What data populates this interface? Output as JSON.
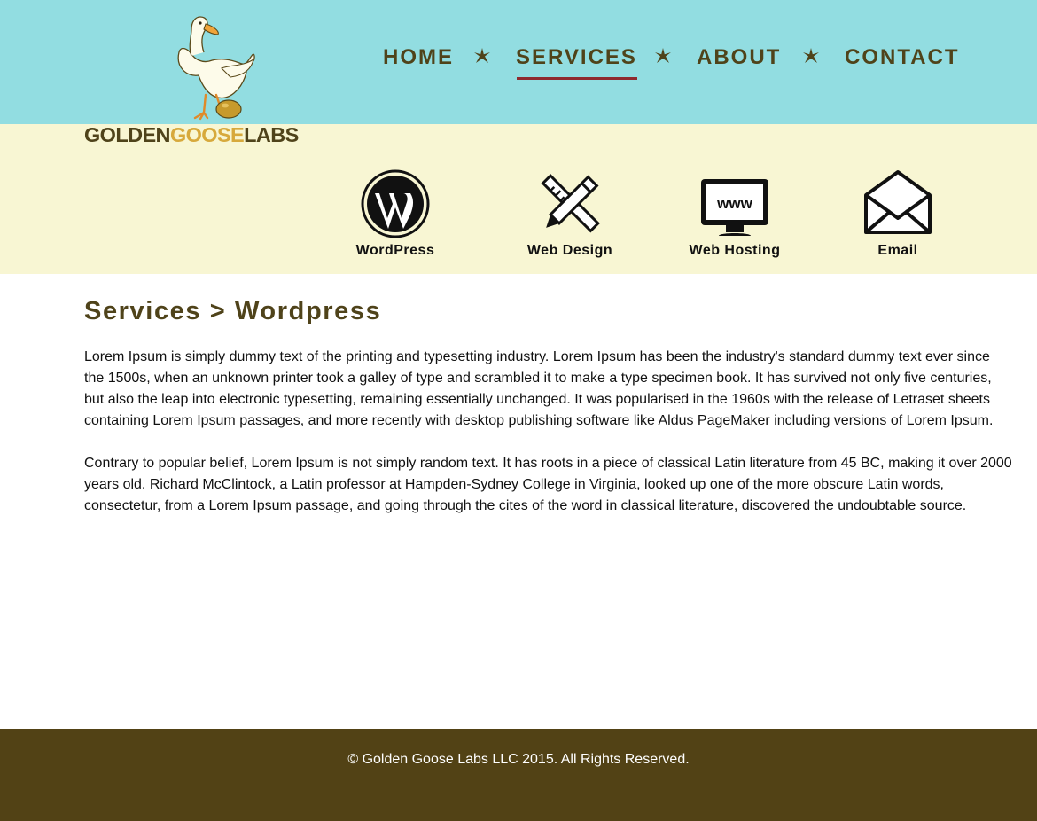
{
  "brand": {
    "logo_part1": "GOLDEN",
    "logo_part2": "GOOSE",
    "logo_part3": "LABS"
  },
  "nav": {
    "items": [
      {
        "label": "HOME",
        "active": false
      },
      {
        "label": "SERVICES",
        "active": true
      },
      {
        "label": "ABOUT",
        "active": false
      },
      {
        "label": "CONTACT",
        "active": false
      }
    ]
  },
  "services": {
    "items": [
      {
        "label": "WordPress",
        "icon": "wordpress-icon"
      },
      {
        "label": "Web Design",
        "icon": "pencil-ruler-icon"
      },
      {
        "label": "Web Hosting",
        "icon": "monitor-www-icon"
      },
      {
        "label": "Email",
        "icon": "envelope-icon"
      }
    ]
  },
  "main": {
    "title": "Services > Wordpress",
    "paragraphs": [
      "Lorem Ipsum is simply dummy text of the printing and typesetting industry. Lorem Ipsum has been the industry's standard dummy text ever since the 1500s, when an unknown printer took a galley of type and scrambled it to make a type specimen book. It has survived not only five centuries, but also the leap into electronic typesetting, remaining essentially unchanged. It was popularised in the 1960s with the release of Letraset sheets containing Lorem Ipsum passages, and more recently with desktop publishing software like Aldus PageMaker including versions of Lorem Ipsum.",
      "Contrary to popular belief, Lorem Ipsum is not simply random text. It has roots in a piece of classical Latin literature from 45 BC, making it over 2000 years old. Richard McClintock, a Latin professor at Hampden-Sydney College in Virginia, looked up one of the more obscure Latin words, consectetur, from a Lorem Ipsum passage, and going through the cites of the word in classical literature, discovered the undoubtable source."
    ]
  },
  "footer": {
    "copyright": "© Golden Goose Labs LLC 2015. All Rights Reserved."
  },
  "colors": {
    "header_bg": "#92dde1",
    "band_bg": "#f8f6d3",
    "brand_brown": "#4f431a",
    "brand_gold": "#d7a93c",
    "active_underline": "#8f2a2f",
    "footer_bg": "#524215"
  }
}
